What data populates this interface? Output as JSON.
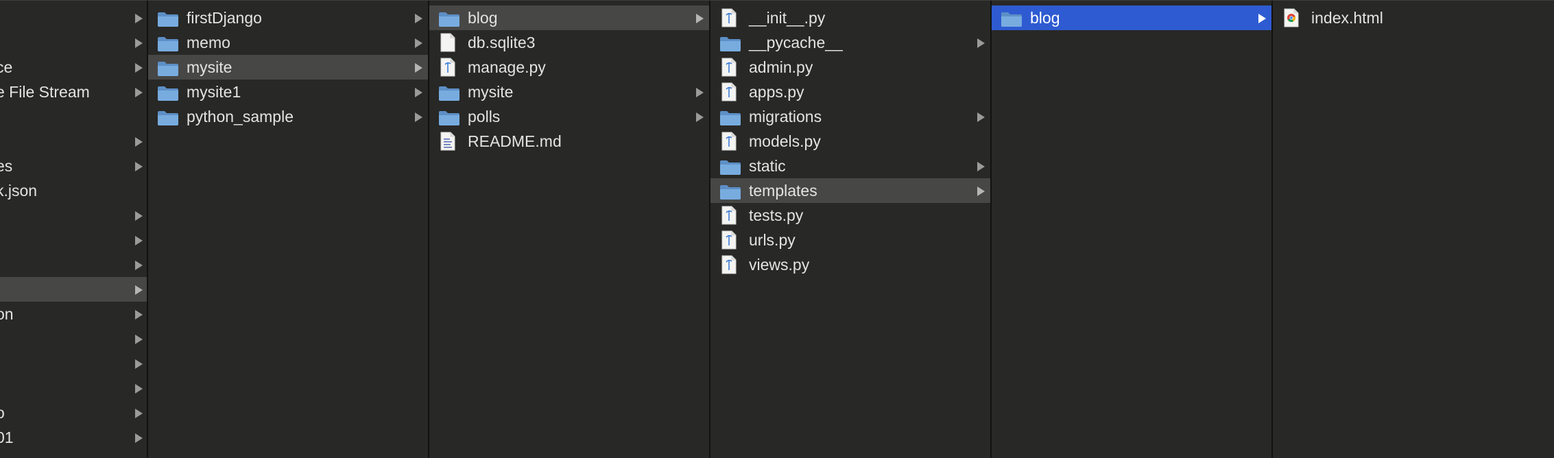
{
  "columns": [
    {
      "id": "col0",
      "rows": [
        {
          "label": "",
          "arrow": true
        },
        {
          "label": "",
          "arrow": true
        },
        {
          "label": "ce",
          "arrow": true
        },
        {
          "label": "e File Stream",
          "arrow": true
        },
        {
          "label": "",
          "arrow": false
        },
        {
          "label": "",
          "arrow": true
        },
        {
          "label": "es",
          "arrow": true
        },
        {
          "label": "k.json",
          "arrow": false
        },
        {
          "label": "",
          "arrow": true
        },
        {
          "label": "",
          "arrow": true
        },
        {
          "label": "",
          "arrow": true
        },
        {
          "label": "",
          "arrow": true,
          "highlight": "gray"
        },
        {
          "label": "on",
          "arrow": true
        },
        {
          "label": "",
          "arrow": true
        },
        {
          "label": "",
          "arrow": true
        },
        {
          "label": "",
          "arrow": true
        },
        {
          "label": "o",
          "arrow": true
        },
        {
          "label": "01",
          "arrow": true
        },
        {
          "label": "",
          "arrow": true
        }
      ]
    },
    {
      "id": "col1",
      "rows": [
        {
          "label": "firstDjango",
          "icon": "folder-icon",
          "arrow": true
        },
        {
          "label": "memo",
          "icon": "folder-icon",
          "arrow": true
        },
        {
          "label": "mysite",
          "icon": "folder-icon",
          "arrow": true,
          "highlight": "gray"
        },
        {
          "label": "mysite1",
          "icon": "folder-icon",
          "arrow": true
        },
        {
          "label": "python_sample",
          "icon": "folder-icon",
          "arrow": true
        }
      ]
    },
    {
      "id": "col2",
      "rows": [
        {
          "label": "blog",
          "icon": "folder-icon",
          "arrow": true,
          "highlight": "gray"
        },
        {
          "label": "db.sqlite3",
          "icon": "blank-file-icon",
          "arrow": false
        },
        {
          "label": "manage.py",
          "icon": "python-file-icon",
          "arrow": false
        },
        {
          "label": "mysite",
          "icon": "folder-icon",
          "arrow": true
        },
        {
          "label": "polls",
          "icon": "folder-icon",
          "arrow": true
        },
        {
          "label": "README.md",
          "icon": "text-file-icon",
          "arrow": false
        }
      ]
    },
    {
      "id": "col3",
      "rows": [
        {
          "label": "__init__.py",
          "icon": "python-file-icon",
          "arrow": false
        },
        {
          "label": "__pycache__",
          "icon": "folder-icon",
          "arrow": true
        },
        {
          "label": "admin.py",
          "icon": "python-file-icon",
          "arrow": false
        },
        {
          "label": "apps.py",
          "icon": "python-file-icon",
          "arrow": false
        },
        {
          "label": "migrations",
          "icon": "folder-icon",
          "arrow": true
        },
        {
          "label": "models.py",
          "icon": "python-file-icon",
          "arrow": false
        },
        {
          "label": "static",
          "icon": "folder-icon",
          "arrow": true
        },
        {
          "label": "templates",
          "icon": "folder-icon",
          "arrow": true,
          "highlight": "gray"
        },
        {
          "label": "tests.py",
          "icon": "python-file-icon",
          "arrow": false
        },
        {
          "label": "urls.py",
          "icon": "python-file-icon",
          "arrow": false
        },
        {
          "label": "views.py",
          "icon": "python-file-icon",
          "arrow": false
        }
      ]
    },
    {
      "id": "col4",
      "rows": [
        {
          "label": "blog",
          "icon": "folder-icon",
          "arrow": true,
          "highlight": "blue"
        }
      ]
    },
    {
      "id": "col5",
      "rows": [
        {
          "label": "index.html",
          "icon": "chrome-html-file-icon",
          "arrow": false
        }
      ]
    }
  ],
  "colors": {
    "background": "#282826",
    "selected_active": "#2e5bd1",
    "selected_inactive": "#474746",
    "folder": "#6fa3d6",
    "text": "#e3e3e1"
  }
}
